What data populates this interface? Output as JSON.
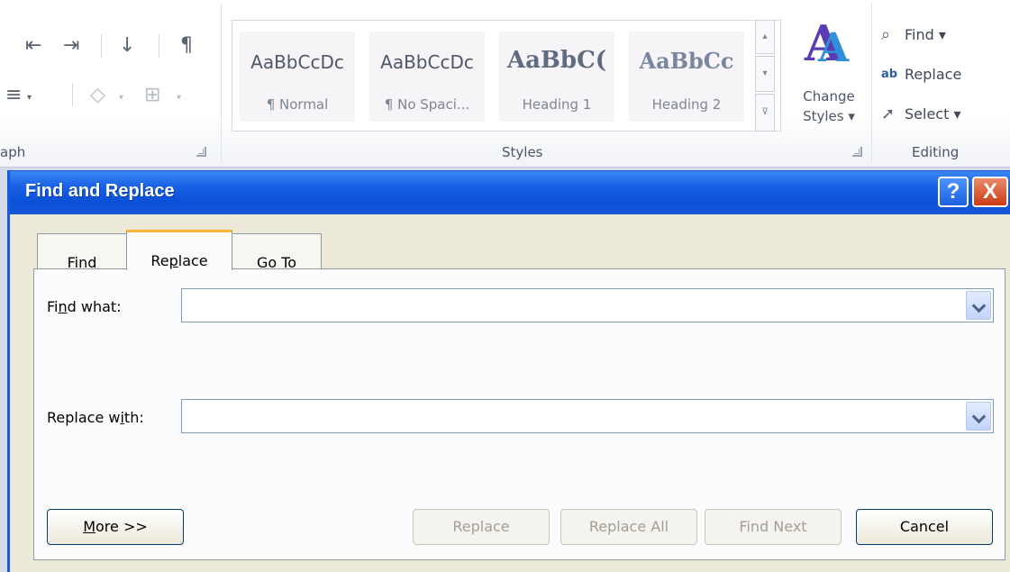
{
  "ribbon": {
    "paragraph_group_label": "aph",
    "styles_group_label": "Styles",
    "editing_group_label": "Editing",
    "styles": [
      {
        "sample": "AaBbCcDc",
        "name": "¶ Normal"
      },
      {
        "sample": "AaBbCcDc",
        "name": "¶ No Spaci..."
      },
      {
        "sample": "AaBbC(",
        "name": "Heading 1"
      },
      {
        "sample": "AaBbCc",
        "name": "Heading 2"
      }
    ],
    "change_styles_line1": "Change",
    "change_styles_line2": "Styles ▾",
    "find_label": "Find ▾",
    "replace_label": "Replace",
    "select_label": "Select ▾"
  },
  "dialog": {
    "title": "Find and Replace",
    "help_glyph": "?",
    "close_glyph": "X",
    "tabs": [
      {
        "pre": "Fin",
        "key": "d",
        "post": ""
      },
      {
        "pre": "Re",
        "key": "p",
        "post": "lace"
      },
      {
        "pre": "",
        "key": "G",
        "post": "o To"
      }
    ],
    "active_tab_index": 1,
    "find_what_label": {
      "pre": "Fi",
      "key": "n",
      "post": "d what:"
    },
    "find_what_value": "",
    "replace_with_label": {
      "pre": "Replace w",
      "key": "i",
      "post": "th:"
    },
    "replace_with_value": "",
    "buttons": {
      "more": {
        "key": "M",
        "post": "ore >>"
      },
      "replace": "Replace",
      "replace_all": "Replace All",
      "find_next": "Find Next",
      "cancel": "Cancel"
    }
  },
  "colors": {
    "titlebar": "#0b51d8",
    "dialog_face": "#ece9d8",
    "active_tab_accent": "#f9b637"
  }
}
